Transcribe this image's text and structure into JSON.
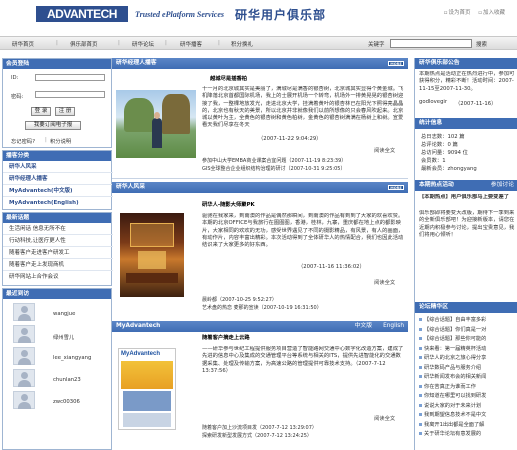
{
  "header": {
    "logo_text": "ADVANTECH",
    "tagline": "Trusted ePlatform Services",
    "site_name": "研华用户俱乐部",
    "set_homepage": "设为首页",
    "add_favorite": "加入收藏"
  },
  "nav": {
    "items": [
      "研华首页",
      "俱乐部首页",
      "研华论坛",
      "研华播客",
      "积分换礼"
    ],
    "keyword_label": "关键字",
    "search_label": "搜索"
  },
  "member_login": {
    "title": "会员登陆",
    "id_label": "ID:",
    "password_label": "密码:",
    "login_button": "登  录",
    "register_button": "注  册",
    "forgot_button": "我要订阅电子报",
    "forgot_password": "忘记密码?",
    "help": "积分说明"
  },
  "podcast_categories": {
    "title": "播客分类",
    "items": [
      "研华人风采",
      "研华经理人播客",
      "MyAdvantech(中文版)",
      "MyAdvantech(English)"
    ]
  },
  "latest_topics": {
    "title": "最新话题",
    "items": [
      "生活闲话  信息无所不在",
      "行动科技,让医疗更人性",
      "随着客户走进客户研发工",
      "随着客户走上发现商机",
      "研华网站上合作会议"
    ]
  },
  "recent_visitors": {
    "title": "最近到访",
    "items": [
      "wangjue",
      "绿州雪儿",
      "lee_xiangyang",
      "chunlan23",
      "zwc00306"
    ]
  },
  "manager_blog": {
    "title": "研华经理人播客",
    "post_title": "越城尽是插香柏",
    "body": "十一月的北京城其实是美丽了，满城尽是满香的银杏树，北京城其实显得个黄金城。飞机降落北京首都国际机场，我上的士展开机场一个转弯，机场外一排黄晃晃的银杏树迎接了我，一整棵地放发光，走进北京大学，挂满着黄叶的银杏林已在阳光下照得亮晶晶的，北京也有秋天的美景，所以北京并非就像我们以前所想像的只会春风吹起来。北京城以黄叶为主，全黄色的银杏树和黄色柏树，金黄色的银杏树满满在杨树上和树。宣爱看天我们尽享在冬天",
    "date": "（2007-11-22 9:04:29）",
    "read_more": "阅读全文",
    "related": [
      "参加中山大学EMBA商业课案合宜问题（2007-11-19 8:23:39）",
      "GIS全球整合企业组织结构治理的研讨（2007-10-31 9:25:05）"
    ]
  },
  "people_style": {
    "title": "研华人风采",
    "post_title": "研华人-随影大师聚PK",
    "body": "驱驰在我家来，到南澳的作品是偶然那瞬间，到南澳的作品有到到了大家的欢喜欢赞。本期的北京OFFICE与我旅行在图图图，香港，桂林，九寨，重庆都在地上点的都影映片，大家相同的欢欢的无功，感受世界遇见了不同的摄影精品，有风景，有人的画面，有动作片，内容丰富出精彩。本次活动得到了全体研华人的热情配合，我们也因此活动结识来了大家更多的好东西。",
    "date": "（2007-11-16 11:36:02）",
    "read_more": "阅读全文",
    "related": [
      "晨岭都（2007-10-25 9:52:27）",
      "艺术盘的热恋  麦那的宣读（2007-10-19 16:31:50）"
    ]
  },
  "myadvantech": {
    "title": "MyAdvantech",
    "lang_zh": "中文版",
    "lang_en": "English",
    "magazine_title": "MyAdvantech",
    "post_title": "随着客户摘走上云路",
    "body": "——研华参与世纪工程提供服务项目营造了智能路网交通中心数字化改造方案，建成了先进的信息中心及集成的交通管理平台等系统与相关的ITS，提供先进智能化的交通数据采集、处理及传输方案，为高速公路的管理提供可靠技术支持。（2007-7-12 13:37:56）",
    "read_more": "阅读全文",
    "related": [
      "随着客户加上沙流项目发（2007-7-12 13:29:07）",
      "探索研发新型发展方式（2007-7-12 13:24:25）"
    ]
  },
  "club_news": {
    "title": "研华俱乐部公告",
    "body": "本期热点是活动正在热烈进行中，参加可获得积分，精彩不断！活动时间：2007-11-15至2007-11-30。",
    "user": "godlovegir",
    "date": "（2007-11-16）"
  },
  "stats": {
    "title": "统计信息",
    "lines": [
      "总日志数：102 篇",
      "总评论数：0 篇",
      "总访问量：9094 位",
      "会员数：1",
      "最新会员：zhongyang"
    ]
  },
  "hot_events": {
    "title": "本期热点活动",
    "participate": "参加讨论",
    "headline": "【本期热点】用户俱乐部马上要变差了",
    "body": "俱乐部即将要变大改版，期待下一季到来的全新俱乐部吧！为迎接新版本，请您在近期内积极参与讨论，提出宝贵意见，我们将用心倾听！"
  },
  "forum_topics": {
    "title": "论坛精华区",
    "items": [
      "【综合话题】自由丰富多彩",
      "【综合话题】你们真是一对",
      "【综合话题】那些你可能的",
      "快来看：第一届精英杯活动",
      "研华人的北京之旅心得分享",
      "研华数码产品与服务介绍",
      "研华新闻发布会的相关新闻",
      "你在苦真正为谁而工作",
      "你知道在哪里可以找到研发",
      "说说大家的对于未来计划",
      "我到期望信息技术不是中文",
      "我离开1出出都是全面了解",
      "关于研华论坛有意发展的"
    ]
  }
}
